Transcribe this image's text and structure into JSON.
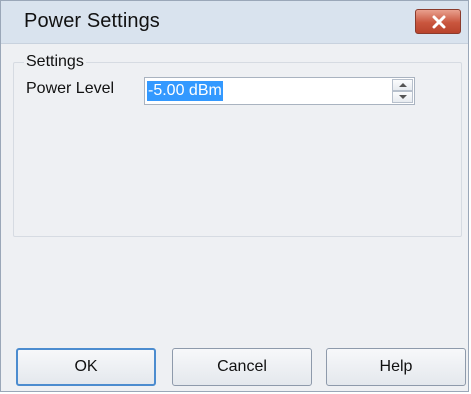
{
  "window": {
    "title": "Power Settings",
    "close_icon": "close-icon"
  },
  "settings_group": {
    "label": "Settings",
    "power_level": {
      "label": "Power Level",
      "value": "-5.00 dBm"
    }
  },
  "buttons": {
    "ok": "OK",
    "cancel": "Cancel",
    "help": "Help"
  },
  "colors": {
    "selection": "#3399ff",
    "close_button": "#c9563e",
    "default_button_border": "#4c8ccf"
  }
}
